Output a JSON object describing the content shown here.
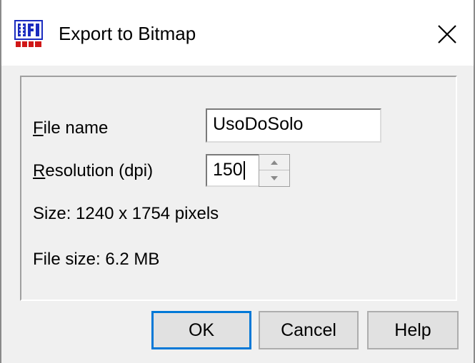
{
  "window": {
    "title": "Export to Bitmap",
    "app_icon": "app-logo-icon",
    "close_icon": "close-icon"
  },
  "form": {
    "file_name_label_first": "F",
    "file_name_label_rest": "ile name",
    "file_name_value": "UsoDoSolo",
    "resolution_label_first": "R",
    "resolution_label_rest": "esolution (dpi)",
    "resolution_value": "150",
    "size_text": "Size: 1240 x 1754 pixels",
    "file_size_text": "File size: 6.2 MB"
  },
  "buttons": {
    "ok": "OK",
    "cancel": "Cancel",
    "help": "Help"
  },
  "colors": {
    "dialog_bg": "#f0f0f0",
    "default_button_border": "#0078d7",
    "app_icon_blue": "#1a2bbf",
    "app_icon_red": "#d01818"
  }
}
